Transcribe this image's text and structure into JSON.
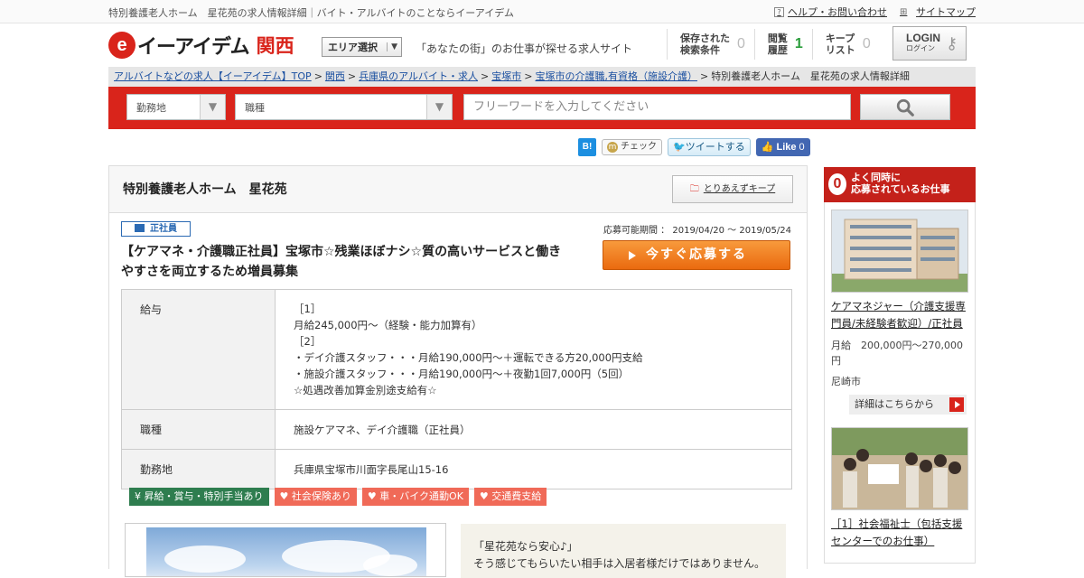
{
  "topbar": {
    "tagline": "特別養護老人ホーム　星花苑の求人情報詳細｜バイト・アルバイトのことならイーアイデム",
    "help_link": "ヘルプ・お問い合わせ",
    "sitemap_link": "サイトマップ"
  },
  "header": {
    "logo_e": "e",
    "logo_text": "イーアイデム",
    "region": "関西",
    "area_select": "エリア選択",
    "catch": "「あなたの街」のお仕事が探せる求人サイト",
    "saved_search": {
      "label_1": "保存された",
      "label_2": "検索条件",
      "count": "0"
    },
    "history": {
      "label_1": "閲覧",
      "label_2": "履歴",
      "count": "1"
    },
    "keep_list": {
      "label_1": "キープ",
      "label_2": "リスト",
      "count": "0"
    },
    "login": {
      "label": "LOGIN",
      "sub": "ログイン"
    }
  },
  "breadcrumb": {
    "items": [
      "アルバイトなどの求人【イーアイデム】TOP",
      "関西",
      "兵庫県のアルバイト・求人",
      "宝塚市",
      "宝塚市の介護職,有資格（施設介護）"
    ],
    "current": "特別養護老人ホーム　星花苑の求人情報詳細"
  },
  "search": {
    "location": "勤務地",
    "job_type": "職種",
    "freeword_placeholder": "フリーワードを入力してください"
  },
  "social": {
    "hatena": "B!",
    "mixi_m": "m",
    "mixi": "チェック",
    "tweet": "ツイートする",
    "like": "Like",
    "like_count": "0"
  },
  "job": {
    "company": "特別養護老人ホーム　星花苑",
    "keep_button": "とりあえずキープ",
    "employment_type": "正社員",
    "period_label": "応募可能期間",
    "period": "2019/04/20 ～ 2019/05/24",
    "title": "【ケアマネ・介護職正社員】宝塚市☆残業ほぼナシ☆質の高いサービスと働きやすさを両立するため増員募集",
    "apply_button": "今すぐ応募する",
    "salary_label": "給与",
    "salary_lines": [
      "［1］",
      "月給245,000円〜（経験・能力加算有）",
      "［2］",
      "・デイ介護スタッフ・・・月給190,000円〜＋運転できる方20,000円支給",
      "・施設介護スタッフ・・・月給190,000円〜＋夜勤1回7,000円（5回）",
      "☆処遇改善加算金別途支給有☆"
    ],
    "jobtype_label": "職種",
    "jobtype": "施設ケアマネ、デイ介護職（正社員）",
    "location_label": "勤務地",
    "location": "兵庫県宝塚市川面字長尾山15-16",
    "tags": [
      {
        "icon": "¥",
        "text": "昇給・賞与・特別手当あり"
      },
      {
        "icon": "♥",
        "text": "社会保険あり"
      },
      {
        "icon": "♥",
        "text": "車・バイク通勤OK"
      },
      {
        "icon": "♥",
        "text": "交通費支給"
      }
    ],
    "quote_lines": [
      "「星花苑なら安心♪」",
      "そう感じてもらいたい相手は入居者様だけではありません。"
    ]
  },
  "sidebar": {
    "head_icon": "0",
    "head_line1": "よく同時に",
    "head_line2": "応募されているお仕事",
    "item1": {
      "title": "ケアマネジャー（介護支援専門員/未経験者歓迎）/正社員",
      "salary": "月給　200,000円～270,000円",
      "place": "尼崎市",
      "more": "詳細はこちらから"
    },
    "item2": {
      "title": "［1］社会福祉士（包括支援センターでのお仕事）"
    }
  },
  "colors": {
    "brand_red": "#d9241b",
    "apply_orange": "#f07d1f",
    "tag_green": "#2e7d4f",
    "tag_pink": "#f06a58",
    "link_blue": "#1a4fa0"
  }
}
